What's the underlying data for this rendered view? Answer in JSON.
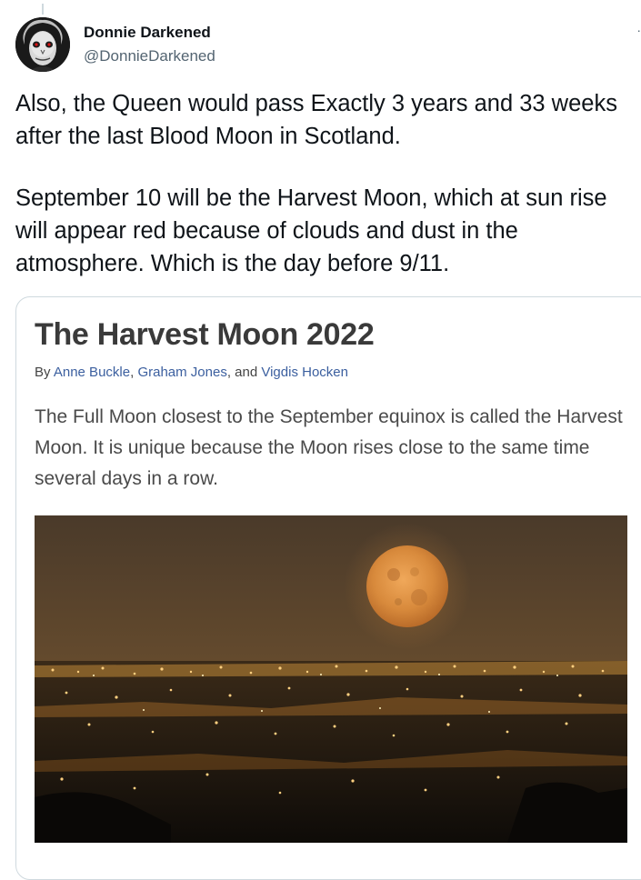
{
  "tweet": {
    "display_name": "Donnie Darkened",
    "handle": "@DonnieDarkened",
    "paragraphs": [
      "Also, the Queen would pass Exactly 3 years and 33 weeks after the last Blood Moon in Scotland.",
      "September 10 will be the Harvest Moon, which at sun rise will appear red because of clouds and dust in the atmosphere. Which is the day before 9/11."
    ]
  },
  "card": {
    "title": "The Harvest Moon 2022",
    "byline": {
      "prefix": "By ",
      "authors": [
        "Anne Buckle",
        "Graham Jones",
        "Vigdis Hocken"
      ],
      "sep1": ", ",
      "sep2": ", and "
    },
    "summary": "The Full Moon closest to the September equinox is called the Harvest Moon. It is unique because the Moon rises close to the same time several days in a row."
  },
  "icons": {
    "avatar": "avatar-face-icon",
    "more": "more-options-icon"
  }
}
